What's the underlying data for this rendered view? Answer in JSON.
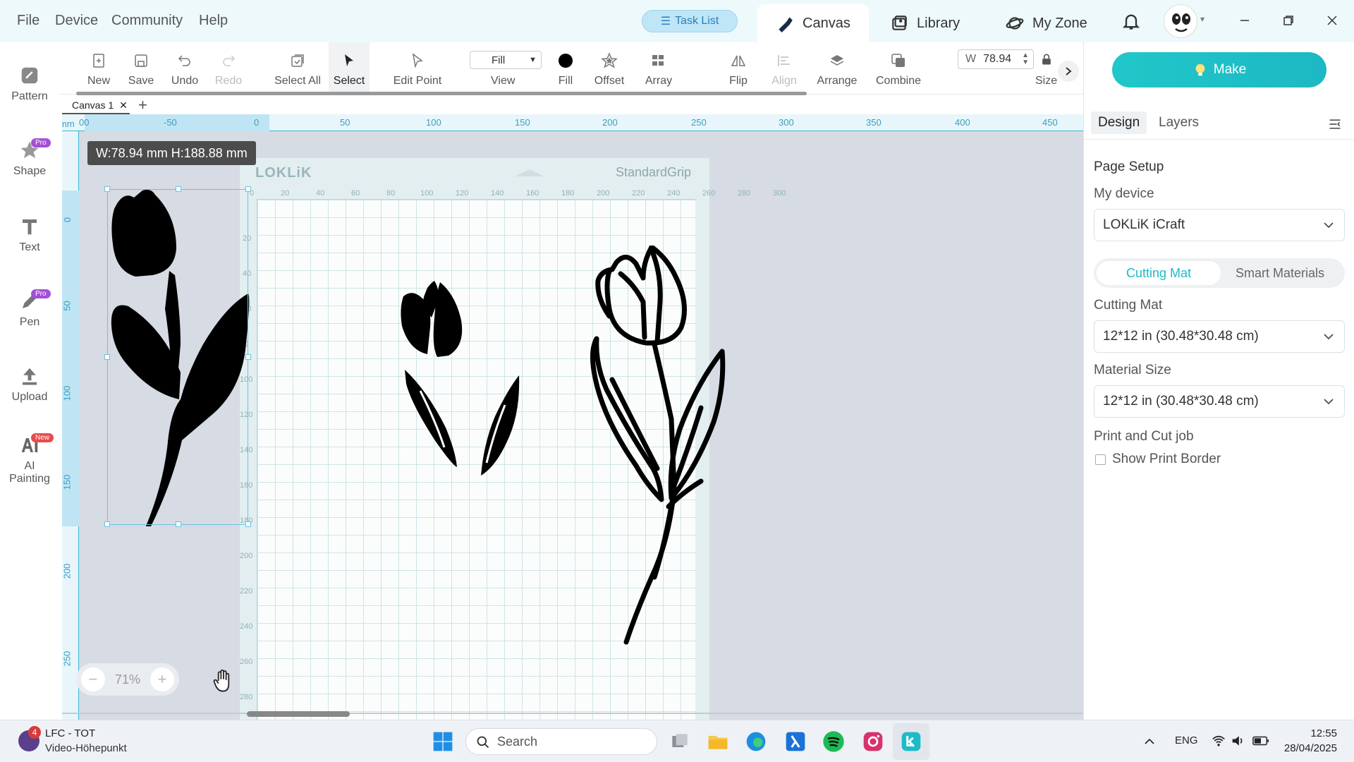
{
  "menu": [
    "File",
    "Device",
    "Community",
    "Help"
  ],
  "task_list": "Task List",
  "top_tabs": {
    "canvas": "Canvas",
    "library": "Library",
    "my_zone": "My Zone"
  },
  "sidebar": {
    "pattern": "Pattern",
    "shape": "Shape",
    "text": "Text",
    "pen": "Pen",
    "upload": "Upload",
    "ai_painting_1": "AI",
    "ai_painting_2": "Painting",
    "badge_pro": "Pro",
    "badge_new": "New"
  },
  "toolbar": {
    "new": "New",
    "save": "Save",
    "undo": "Undo",
    "redo": "Redo",
    "select_all": "Select All",
    "select": "Select",
    "edit_point": "Edit Point",
    "view_value": "Fill",
    "view": "View",
    "fill": "Fill",
    "offset": "Offset",
    "array": "Array",
    "flip": "Flip",
    "align": "Align",
    "arrange": "Arrange",
    "combine": "Combine",
    "size_prefix": "W",
    "size_value": "78.94",
    "size": "Size"
  },
  "canvas_tab": "Canvas 1",
  "selection_label": "W:78.94 mm  H:188.88 mm",
  "ruler": {
    "unit": "mm",
    "h": [
      "00",
      "-50",
      "0",
      "50",
      "100",
      "150",
      "200",
      "250",
      "300",
      "350",
      "400",
      "450"
    ],
    "v": [
      "0",
      "50",
      "100",
      "150",
      "200",
      "250"
    ]
  },
  "mat": {
    "brand": "LOKLiK",
    "grip": "StandardGrip",
    "h": [
      "0",
      "20",
      "40",
      "60",
      "80",
      "100",
      "120",
      "140",
      "160",
      "180",
      "200",
      "220",
      "240",
      "260",
      "280",
      "300"
    ],
    "v": [
      "20",
      "40",
      "60",
      "80",
      "100",
      "120",
      "140",
      "160",
      "180",
      "200",
      "220",
      "240",
      "260",
      "280"
    ]
  },
  "zoom": "71%",
  "right_panel": {
    "make": "Make",
    "tab_design": "Design",
    "tab_layers": "Layers",
    "page_setup": "Page Setup",
    "my_device": "My device",
    "device_value": "LOKLiK iCraft",
    "seg_cutting": "Cutting Mat",
    "seg_smart": "Smart Materials",
    "cutting_mat": "Cutting Mat",
    "cutting_mat_value": "12*12 in (30.48*30.48 cm)",
    "material_size": "Material Size",
    "material_size_value": "12*12 in (30.48*30.48 cm)",
    "print_cut": "Print and Cut job",
    "show_print_border": "Show Print Border"
  },
  "taskbar": {
    "media_badge": "4",
    "media_title": "LFC - TOT",
    "media_sub": "Video-Höhepunkt",
    "search": "Search",
    "lang": "ENG",
    "time": "12:55",
    "date": "28/04/2025"
  },
  "colors": {
    "accent": "#1fbac8",
    "ruler": "#3bb6d6",
    "make_gradient_start": "#20c7c9"
  }
}
